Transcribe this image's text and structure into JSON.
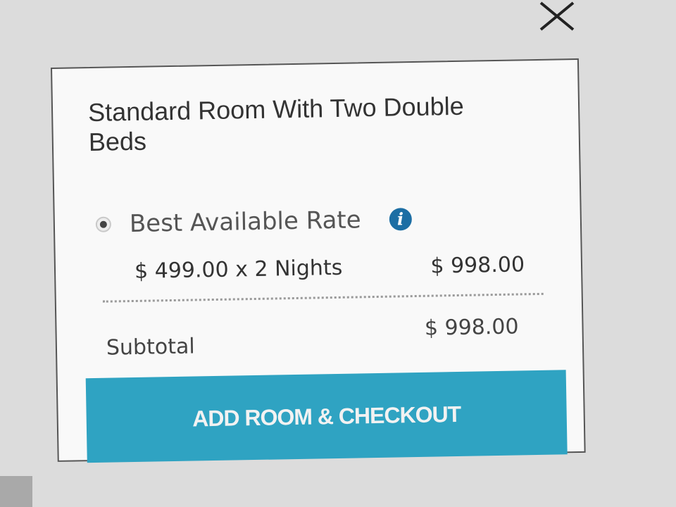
{
  "room": {
    "title": "Standard Room With Two Double Beds",
    "rate_option": {
      "label": "Best Available Rate",
      "selected": true,
      "info_icon": "info-icon",
      "info_glyph": "i"
    },
    "line_item": {
      "description": "$ 499.00 x 2 Nights",
      "amount": "$ 998.00"
    },
    "subtotal": {
      "label": "Subtotal",
      "amount": "$ 998.00"
    },
    "checkout_button_label": "ADD ROOM & CHECKOUT"
  },
  "close_icon": "close-icon",
  "colors": {
    "accent": "#2fa3c2",
    "info": "#1c6ea4"
  }
}
